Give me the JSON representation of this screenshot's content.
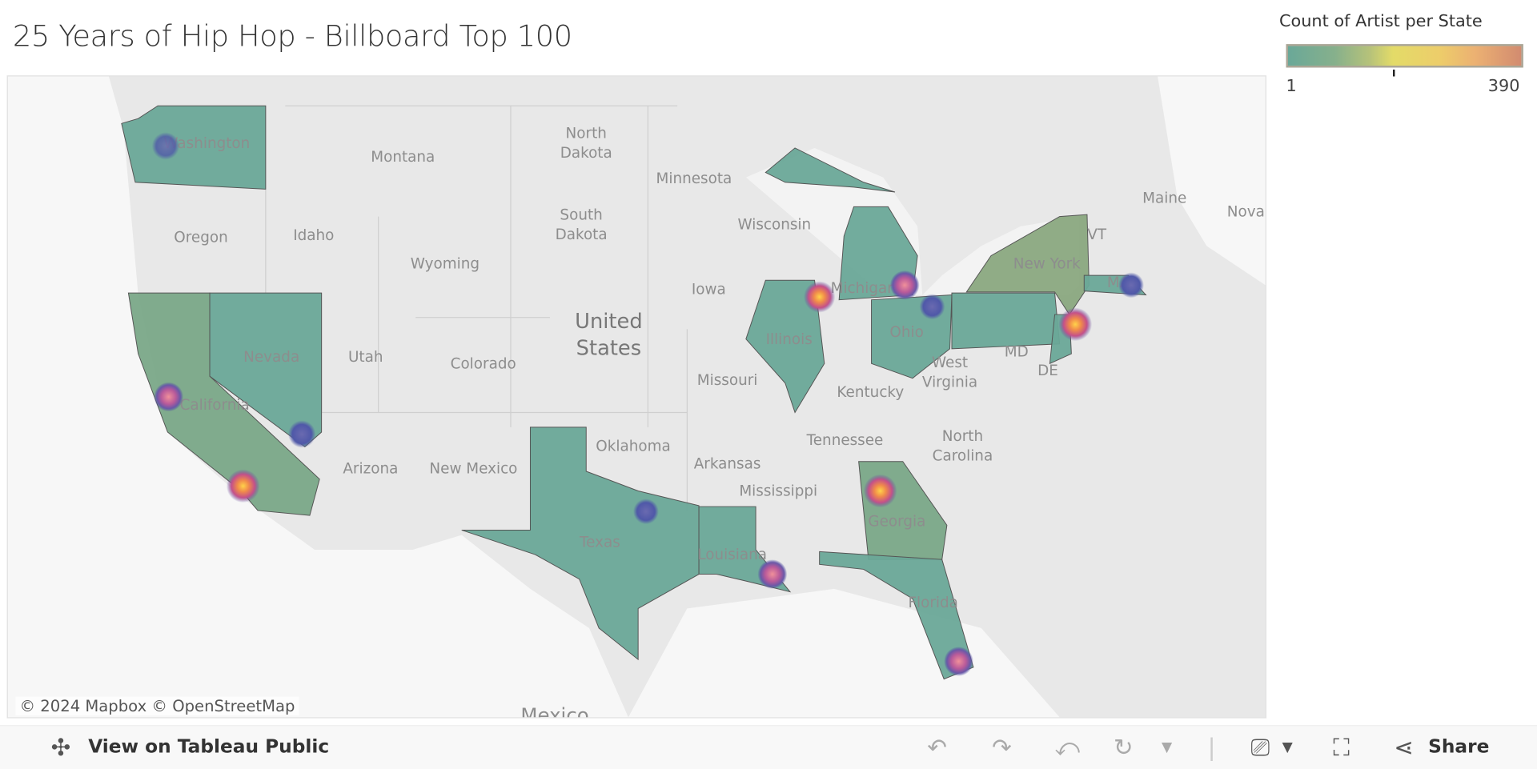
{
  "header": {
    "title": "25 Years of Hip Hop - Billboard Top 100"
  },
  "legend": {
    "title": "Count of Artist per State",
    "min": "1",
    "max": "390",
    "colors": [
      "#6aa898",
      "#e3db68",
      "#d28b70"
    ]
  },
  "map": {
    "credits": "© 2024 Mapbox  © OpenStreetMap",
    "highlighted_states": [
      "Washington",
      "California",
      "Nevada",
      "Texas",
      "Louisiana",
      "Illinois",
      "Michigan",
      "Ohio",
      "Pennsylvania",
      "New York",
      "New Jersey",
      "Massachusetts",
      "Georgia",
      "Florida"
    ],
    "labels": {
      "washington": "Washington",
      "montana": "Montana",
      "north_dakota_1": "North",
      "north_dakota_2": "Dakota",
      "minnesota": "Minnesota",
      "oregon": "Oregon",
      "idaho": "Idaho",
      "south_dakota_1": "South",
      "south_dakota_2": "Dakota",
      "wyoming": "Wyoming",
      "wisconsin": "Wisconsin",
      "michigan": "Michigan",
      "iowa": "Iowa",
      "new_york": "New York",
      "maine": "Maine",
      "nova": "Nova",
      "vt": "VT",
      "ma": "MA",
      "us_1": "United",
      "us_2": "States",
      "nevada": "Nevada",
      "utah": "Utah",
      "colorado": "Colorado",
      "illinois": "Illinois",
      "ohio": "Ohio",
      "md": "MD",
      "de": "DE",
      "west_virginia_1": "West",
      "west_virginia_2": "Virginia",
      "missouri": "Missouri",
      "kentucky": "Kentucky",
      "california": "California",
      "tennessee": "Tennessee",
      "north_carolina_1": "North",
      "north_carolina_2": "Carolina",
      "oklahoma": "Oklahoma",
      "arizona": "Arizona",
      "new_mexico": "New Mexico",
      "arkansas": "Arkansas",
      "mississippi": "Mississippi",
      "georgia": "Georgia",
      "texas": "Texas",
      "louisiana": "Louisiana",
      "florida": "Florida",
      "mexico": "Mexico"
    }
  },
  "toolbar": {
    "view_label": "View on Tableau Public",
    "share_label": "Share"
  }
}
